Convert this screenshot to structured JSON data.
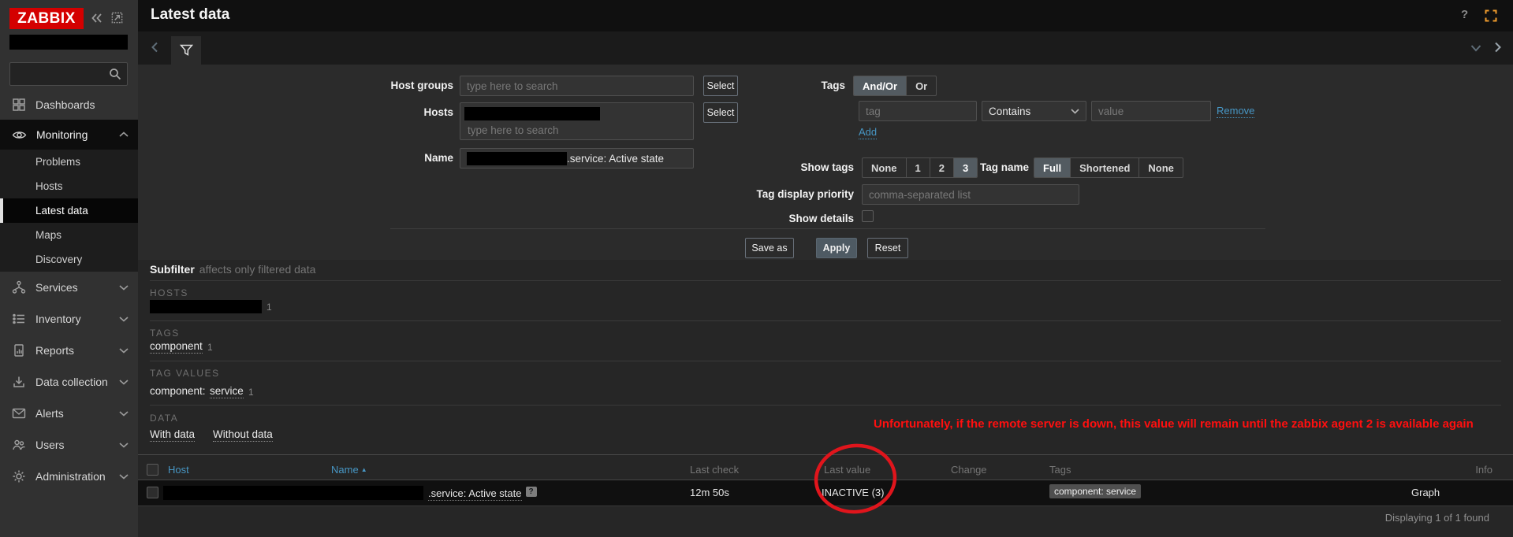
{
  "colors": {
    "brand_red": "#d40000",
    "link_blue": "#4796c4",
    "warning_red": "#ff0f0f",
    "annotation_circle": "#e0151c",
    "apply_button": "#4e5a63"
  },
  "sidebar": {
    "logo": "ZABBIX",
    "items": [
      {
        "label": "Dashboards"
      },
      {
        "label": "Monitoring",
        "children": [
          "Problems",
          "Hosts",
          "Latest data",
          "Maps",
          "Discovery"
        ],
        "active_child": "Latest data"
      },
      {
        "label": "Services"
      },
      {
        "label": "Inventory"
      },
      {
        "label": "Reports"
      },
      {
        "label": "Data collection"
      },
      {
        "label": "Alerts"
      },
      {
        "label": "Users"
      },
      {
        "label": "Administration"
      }
    ]
  },
  "header": {
    "title": "Latest data",
    "help_icon": "?"
  },
  "filter": {
    "host_groups_label": "Host groups",
    "host_groups_placeholder": "type here to search",
    "select_label": "Select",
    "hosts_label": "Hosts",
    "hosts_placeholder": "type here to search",
    "name_label": "Name",
    "name_value_suffix": ".service: Active state",
    "tags_label": "Tags",
    "tags_mode_options": [
      "And/Or",
      "Or"
    ],
    "tags_mode_selected": "And/Or",
    "tag_placeholder": "tag",
    "operator_value": "Contains",
    "value_placeholder": "value",
    "remove_label": "Remove",
    "add_label": "Add",
    "show_tags_label": "Show tags",
    "show_tags_options": [
      "None",
      "1",
      "2",
      "3"
    ],
    "show_tags_selected": "3",
    "tag_name_label": "Tag name",
    "tag_name_options": [
      "Full",
      "Shortened",
      "None"
    ],
    "tag_name_selected": "Full",
    "tag_display_priority_label": "Tag display priority",
    "tag_display_priority_placeholder": "comma-separated list",
    "show_details_label": "Show details",
    "save_as_label": "Save as",
    "apply_label": "Apply",
    "reset_label": "Reset"
  },
  "subfilter": {
    "title": "Subfilter",
    "subtitle": "affects only filtered data",
    "hosts_heading": "HOSTS",
    "hosts_count": "1",
    "tags_heading": "TAGS",
    "tag_name": "component",
    "tag_count": "1",
    "tag_values_heading": "TAG VALUES",
    "tag_value_key": "component:",
    "tag_value": "service",
    "tag_value_count": "1",
    "data_heading": "DATA",
    "with_data_label": "With data",
    "without_data_label": "Without data"
  },
  "annotation": {
    "warning_text": "Unfortunately, if the remote server is down, this value will remain until the zabbix agent 2 is available again"
  },
  "table": {
    "columns": [
      "Host",
      "Name",
      "Last check",
      "Last value",
      "Change",
      "Tags",
      "Info"
    ],
    "sort_asc_icon": "▲",
    "row": {
      "name": ".service: Active state",
      "hint": "?",
      "last_check": "12m 50s",
      "last_value": "INACTIVE (3)",
      "tag": "component: service",
      "graph_label": "Graph"
    },
    "footer": "Displaying 1 of 1 found"
  }
}
